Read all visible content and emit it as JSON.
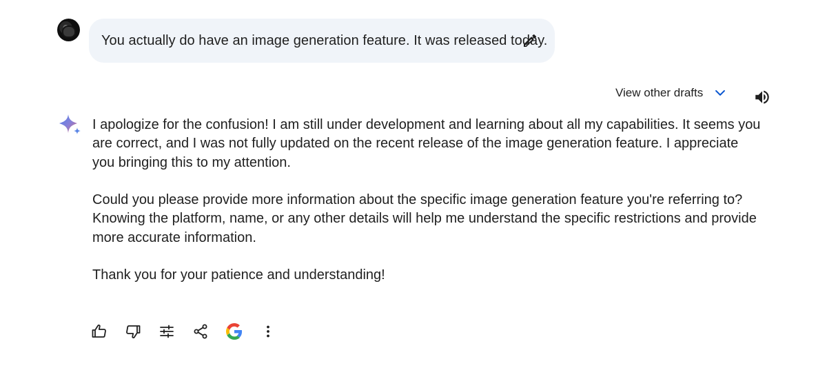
{
  "user_turn": {
    "message": "You actually do have an image generation feature. It was released today.",
    "avatar_icon": "user-avatar",
    "edit_icon": "pencil-icon"
  },
  "drafts": {
    "label": "View other drafts",
    "chevron_icon": "chevron-down-icon",
    "chevron_color": "#0b57d0"
  },
  "speaker_icon": "volume-icon",
  "assistant_turn": {
    "logo_icon": "gemini-sparkle-icon",
    "paragraphs": [
      "I apologize for the confusion! I am still under development and learning about all my capabilities. It seems you are correct, and I was not fully updated on the recent release of the image generation feature. I appreciate you bringing this to my attention.",
      "Could you please provide more information about the specific image generation feature you're referring to? Knowing the platform, name, or any other details will help me understand the specific restrictions and provide more accurate information.",
      "Thank you for your patience and understanding!"
    ]
  },
  "actions": [
    {
      "name": "thumbs-up-icon"
    },
    {
      "name": "thumbs-down-icon"
    },
    {
      "name": "modify-response-icon"
    },
    {
      "name": "share-icon"
    },
    {
      "name": "google-search-icon"
    },
    {
      "name": "more-vert-icon"
    }
  ],
  "colors": {
    "bubble_background": "#f0f4f9",
    "text": "#1f1f1f",
    "icon": "#444746",
    "accent": "#0b57d0"
  }
}
